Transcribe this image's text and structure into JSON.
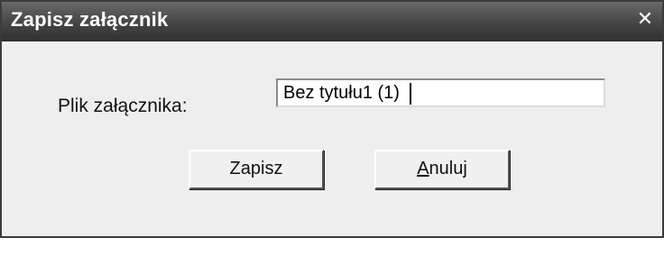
{
  "dialog": {
    "title": "Zapisz załącznik",
    "close_glyph": "✕"
  },
  "form": {
    "file_label": "Plik załącznika:",
    "file_value": "Bez tytułu1 (1)"
  },
  "buttons": {
    "save_label": "Zapisz",
    "cancel_first": "A",
    "cancel_rest": "nuluj"
  }
}
